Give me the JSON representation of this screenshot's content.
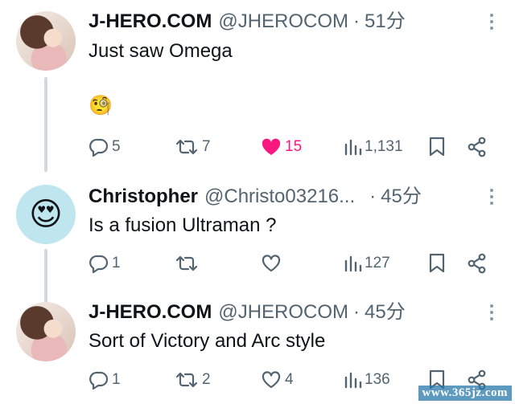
{
  "tweets": [
    {
      "name": "J-HERO.COM",
      "handle": "@JHEROCOM",
      "time": "51分",
      "text": "Just saw Omega",
      "emoji": "🧐",
      "replies": "5",
      "retweets": "7",
      "likes": "15",
      "views": "1,131",
      "liked": true
    },
    {
      "name": "Christopher",
      "handle": "@Christo03216...",
      "time": "45分",
      "avatar_emoji": "😍",
      "text": "Is a fusion Ultraman ?",
      "replies": "1",
      "retweets": "",
      "likes": "",
      "views": "127",
      "liked": false
    },
    {
      "name": "J-HERO.COM",
      "handle": "@JHEROCOM",
      "time": "45分",
      "text": "Sort of Victory and Arc style",
      "replies": "1",
      "retweets": "2",
      "likes": "4",
      "views": "136",
      "liked": false
    }
  ],
  "separator": "·",
  "watermark": "www.365jz.com",
  "colors": {
    "like_active": "#f91880",
    "muted": "#536471",
    "thread_line": "#cfd9de"
  }
}
